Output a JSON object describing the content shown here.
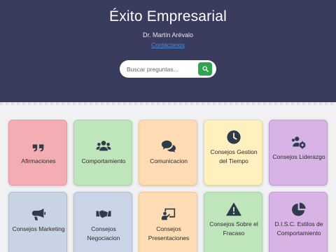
{
  "header": {
    "title": "Éxito Empresarial",
    "author": "Dr. Martín Arévalo",
    "author_link": "Contáctanos"
  },
  "search": {
    "placeholder": "Buscar preguntas...",
    "button_icon": "search-icon",
    "button_color": "#2ea44f"
  },
  "colors": {
    "header_bg": "#393c5d",
    "page_bg": "#f1f1f3"
  },
  "cards": [
    {
      "label": "Afirmaciones",
      "icon": "quote-icon",
      "color": "#f4aeb3"
    },
    {
      "label": "Comportamiento",
      "icon": "users-icon",
      "color": "#bfe5bd"
    },
    {
      "label": "Comunicacion",
      "icon": "comments-icon",
      "color": "#ffdcb3"
    },
    {
      "label": "Consejos Gestion del Tiempo",
      "icon": "clock-icon",
      "color": "#fff0bf"
    },
    {
      "label": "Consejos Liderazgo",
      "icon": "users-gear-icon",
      "color": "#d7b3e6"
    },
    {
      "label": "Consejos Marketing",
      "icon": "megaphone-icon",
      "color": "#c8d3e3"
    },
    {
      "label": "Consejos Negociacion",
      "icon": "handshake-icon",
      "color": "#c9d5e6"
    },
    {
      "label": "Consejos Presentaciones",
      "icon": "presentation-icon",
      "color": "#ffdcb3"
    },
    {
      "label": "Consejos Sobre el Fracaso",
      "icon": "warning-icon",
      "color": "#bfe5bd"
    },
    {
      "label": "D.I.S.C. Estilos de Comportamiento",
      "icon": "pie-chart-icon",
      "color": "#d7b3e6"
    }
  ]
}
